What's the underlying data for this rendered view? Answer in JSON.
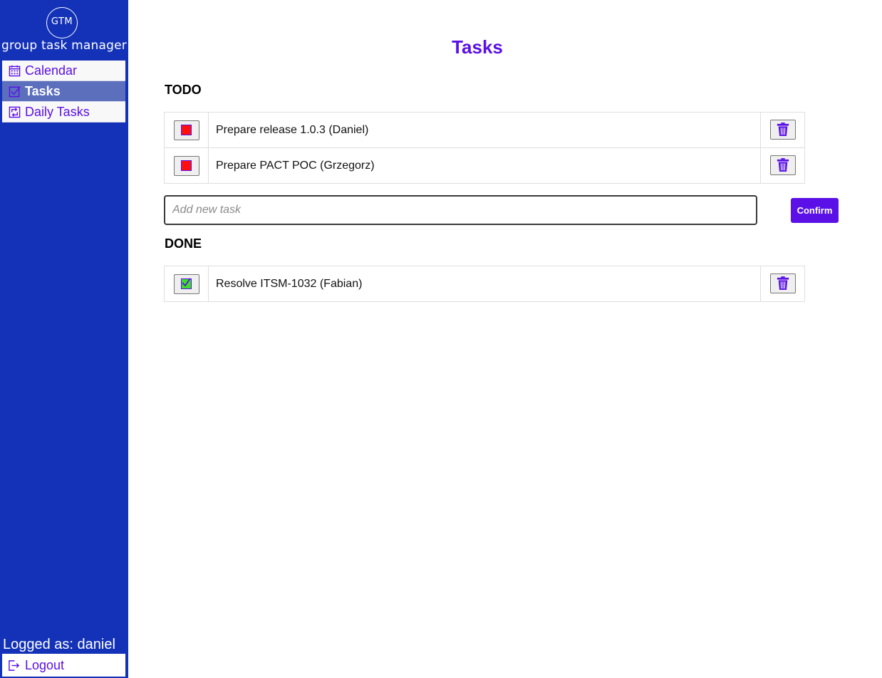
{
  "app": {
    "logo_abbr": "GTM",
    "logo_text": "group task manager"
  },
  "sidebar": {
    "items": [
      {
        "label": "Calendar",
        "icon": "calendar-icon",
        "active": false
      },
      {
        "label": "Tasks",
        "icon": "checkbox-icon",
        "active": true
      },
      {
        "label": "Daily Tasks",
        "icon": "repeat-icon",
        "active": false
      }
    ],
    "logged_as": "Logged as: daniel",
    "logout_label": "Logout"
  },
  "main": {
    "title": "Tasks",
    "todo_heading": "TODO",
    "done_heading": "DONE",
    "todo": [
      {
        "text": "Prepare release 1.0.3 (Daniel)",
        "done": false
      },
      {
        "text": "Prepare PACT POC (Grzegorz)",
        "done": false
      }
    ],
    "done": [
      {
        "text": "Resolve ITSM-1032 (Fabian)",
        "done": true
      }
    ],
    "new_task_placeholder": "Add new task",
    "confirm_label": "Confirm"
  },
  "colors": {
    "sidebar_bg": "#1332b8",
    "accent": "#5a10e6",
    "active_nav_bg": "#5b6fbd",
    "todo_box": "#ff1010",
    "done_box": "#3ddc2a"
  }
}
